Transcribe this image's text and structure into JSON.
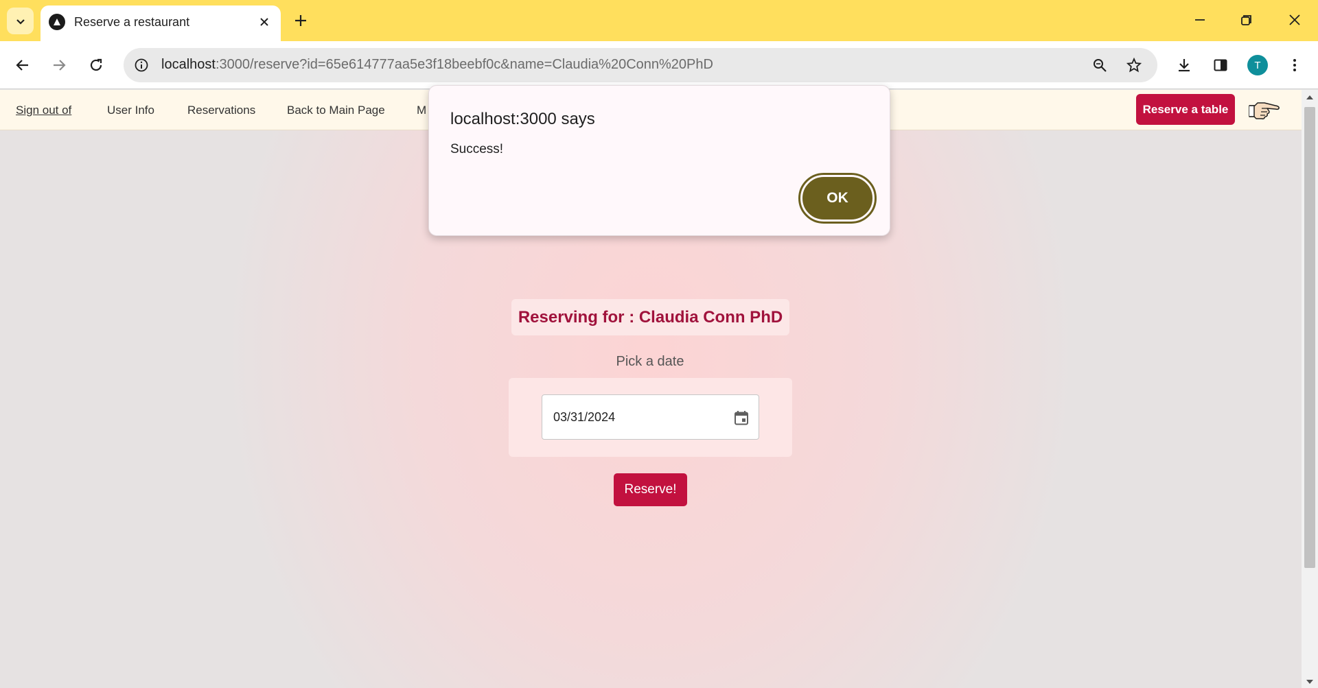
{
  "browser": {
    "tab_title": "Reserve a restaurant",
    "url_host": "localhost",
    "url_rest": ":3000/reserve?id=65e614777aa5e3f18beebf0c&name=Claudia%20Conn%20PhD",
    "profile_initial": "T"
  },
  "nav": {
    "items": [
      "Sign out of",
      "User Info",
      "Reservations",
      "Back to Main Page",
      "M"
    ],
    "cta_label": "Reserve a table"
  },
  "main": {
    "reserving_for": "Reserving for : Claudia Conn PhD",
    "pick_label": "Pick a date",
    "date_value": "03/31/2024",
    "reserve_label": "Reserve!"
  },
  "dialog": {
    "title": "localhost:3000 says",
    "message": "Success!",
    "ok_label": "OK"
  },
  "colors": {
    "tabbar": "#ffdf5d",
    "brand_red": "#c2113f",
    "ok_button": "#6b5f1e"
  }
}
